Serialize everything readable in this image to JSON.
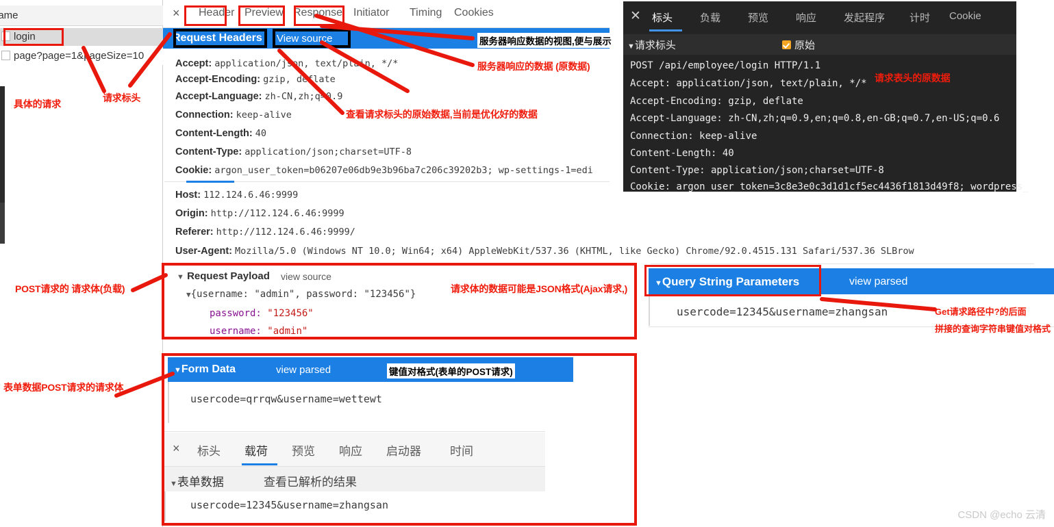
{
  "left_panel": {
    "column_header": "lame",
    "rows": [
      {
        "name": "login",
        "selected": true
      },
      {
        "name": "page?page=1&pageSize=10",
        "selected": false
      }
    ]
  },
  "center_panel": {
    "close_icon": "×",
    "tabs": [
      "Header",
      "Preview",
      "Response",
      "Initiator",
      "Timing",
      "Cookies"
    ],
    "request_headers_section": {
      "title": "Request Headers",
      "view_source_label": "View source",
      "headers": [
        {
          "key": "Accept:",
          "value": "application/json, text/plain, */*"
        },
        {
          "key": "Accept-Encoding:",
          "value": "gzip, deflate"
        },
        {
          "key": "Accept-Language:",
          "value": "zh-CN,zh;q=0.9"
        },
        {
          "key": "Connection:",
          "value": "keep-alive"
        },
        {
          "key": "Content-Length:",
          "value": "40"
        },
        {
          "key": "Content-Type:",
          "value": "application/json;charset=UTF-8"
        },
        {
          "key": "Cookie:",
          "value": "argon_user_token=b06207e06db9e3b96ba7c206c39202b3; wp-settings-1=edi"
        }
      ],
      "headers2": [
        {
          "key": "Host:",
          "value": "112.124.6.46:9999"
        },
        {
          "key": "Origin:",
          "value": "http://112.124.6.46:9999"
        },
        {
          "key": "Referer:",
          "value": "http://112.124.6.46:9999/"
        },
        {
          "key": "User-Agent:",
          "value": "Mozilla/5.0 (Windows NT 10.0; Win64; x64) AppleWebKit/537.36 (KHTML, like Gecko) Chrome/92.0.4515.131 Safari/537.36 SLBrow"
        }
      ]
    },
    "request_payload_section": {
      "title": "Request Payload",
      "view_source_label": "view source",
      "root_line": "{username: \"admin\", password: \"123456\"}",
      "fields": [
        {
          "key": "password:",
          "value": "\"123456\""
        },
        {
          "key": "username:",
          "value": "\"admin\""
        }
      ]
    },
    "form_data_section": {
      "title": "Form Data",
      "view_parsed_label": "view parsed",
      "value": "usercode=qrrqw&username=wettewt"
    },
    "cn_devtools_inset": {
      "close_icon": "×",
      "tabs": [
        "标头",
        "载荷",
        "预览",
        "响应",
        "启动器",
        "时间"
      ],
      "active_tab_index": 1,
      "section_title": "表单数据",
      "view_parsed_label": "查看已解析的结果",
      "value": "usercode=12345&username=zhangsan"
    }
  },
  "query_string_section": {
    "title": "Query String Parameters",
    "view_parsed_label": "view parsed",
    "value": "usercode=12345&username=zhangsan"
  },
  "dark_panel": {
    "close_icon": "✕",
    "tabs": [
      "标头",
      "负载",
      "预览",
      "响应",
      "发起程序",
      "计时",
      "Cookie"
    ],
    "active_tab_index": 0,
    "section_title": "请求标头",
    "raw_checkbox_label": "原始",
    "raw_checked": true,
    "raw_lines": [
      "POST /api/employee/login HTTP/1.1",
      "Accept: application/json, text/plain, */*",
      "Accept-Encoding: gzip, deflate",
      "Accept-Language: zh-CN,zh;q=0.9,en;q=0.8,en-GB;q=0.7,en-US;q=0.6",
      "Connection: keep-alive",
      "Content-Length: 40",
      "Content-Type: application/json;charset=UTF-8",
      "Cookie: argon_user_token=3c8e3e0c3d1d1cf5ec4436f1813d49f8; wordpress_"
    ]
  },
  "annotations": {
    "a1": "具体的请求",
    "a2": "请求标头",
    "a3": "服务器响应数据的视图,便与展示",
    "a4": "服务器响应的数据 (原数据)",
    "a5": "查看请求标头的原始数据,当前是优化好的数据",
    "a6": "请求表头的原数据",
    "a7": "POST请求的 请求体(负载)",
    "a8": "请求体的数据可能是JSON格式(Ajax请求,)",
    "a9": "Get请求路径中?的后面",
    "a10": "拼接的查询字符串键值对格式",
    "a11": "表单数据POST请求的请求体",
    "a12": "键值对格式(表单的POST请求)"
  },
  "watermark": "CSDN @echo 云清",
  "colors": {
    "accent_blue": "#1b7fe3",
    "annotation_red": "#f01c0c",
    "dark_bg": "#242424"
  }
}
